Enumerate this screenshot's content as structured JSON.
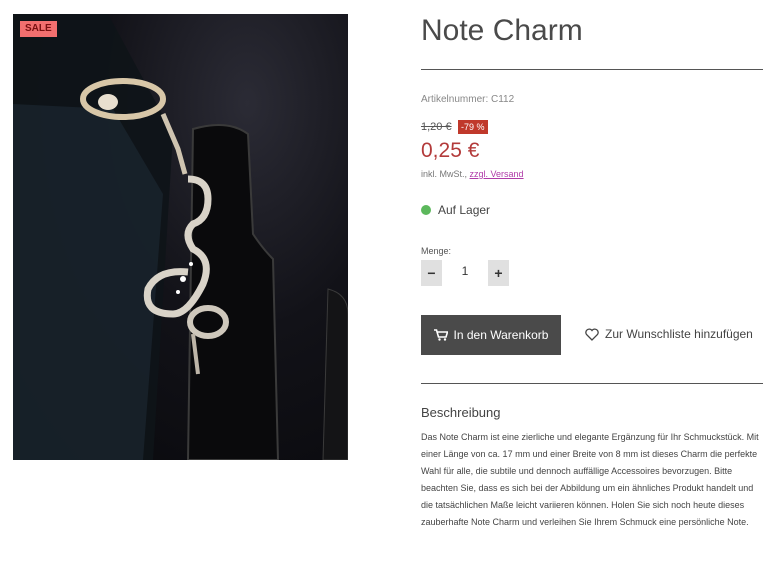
{
  "badge": {
    "sale": "SALE"
  },
  "product": {
    "title": "Note Charm",
    "sku": "Artikelnummer: C112",
    "old_price": "1,20 €",
    "discount": "-79 %",
    "price": "0,25 €",
    "tax_text": "inkl. MwSt.,",
    "shipping_link": "zzgl. Versand",
    "stock": "Auf Lager",
    "stock_color": "#5cb85c"
  },
  "quantity": {
    "label": "Menge:",
    "minus": "−",
    "value": "1",
    "plus": "+"
  },
  "actions": {
    "add_to_cart": "In den Warenkorb",
    "wishlist": "Zur Wunschliste hinzufügen"
  },
  "description": {
    "title": "Beschreibung",
    "text": "Das Note Charm ist eine zierliche und elegante Ergänzung für Ihr Schmuckstück. Mit einer Länge von ca. 17 mm und einer Breite von 8 mm ist dieses Charm die perfekte Wahl für alle, die subtile und dennoch auffällige Accessoires bevorzugen. Bitte beachten Sie, dass es sich bei der Abbildung um ein ähnliches Produkt handelt und die tatsächlichen Maße leicht variieren können. Holen Sie sich noch heute dieses zauberhafte Note Charm und verleihen Sie Ihrem Schmuck eine persönliche Note."
  },
  "icons": {
    "cart": "cart-icon",
    "wishlist": "heart-icon",
    "stock": "status-dot-icon"
  },
  "colors": {
    "price": "#b33a3a",
    "sale_badge": "#f26f6f",
    "discount_badge": "#c0392b",
    "button": "#4a4a4a"
  }
}
